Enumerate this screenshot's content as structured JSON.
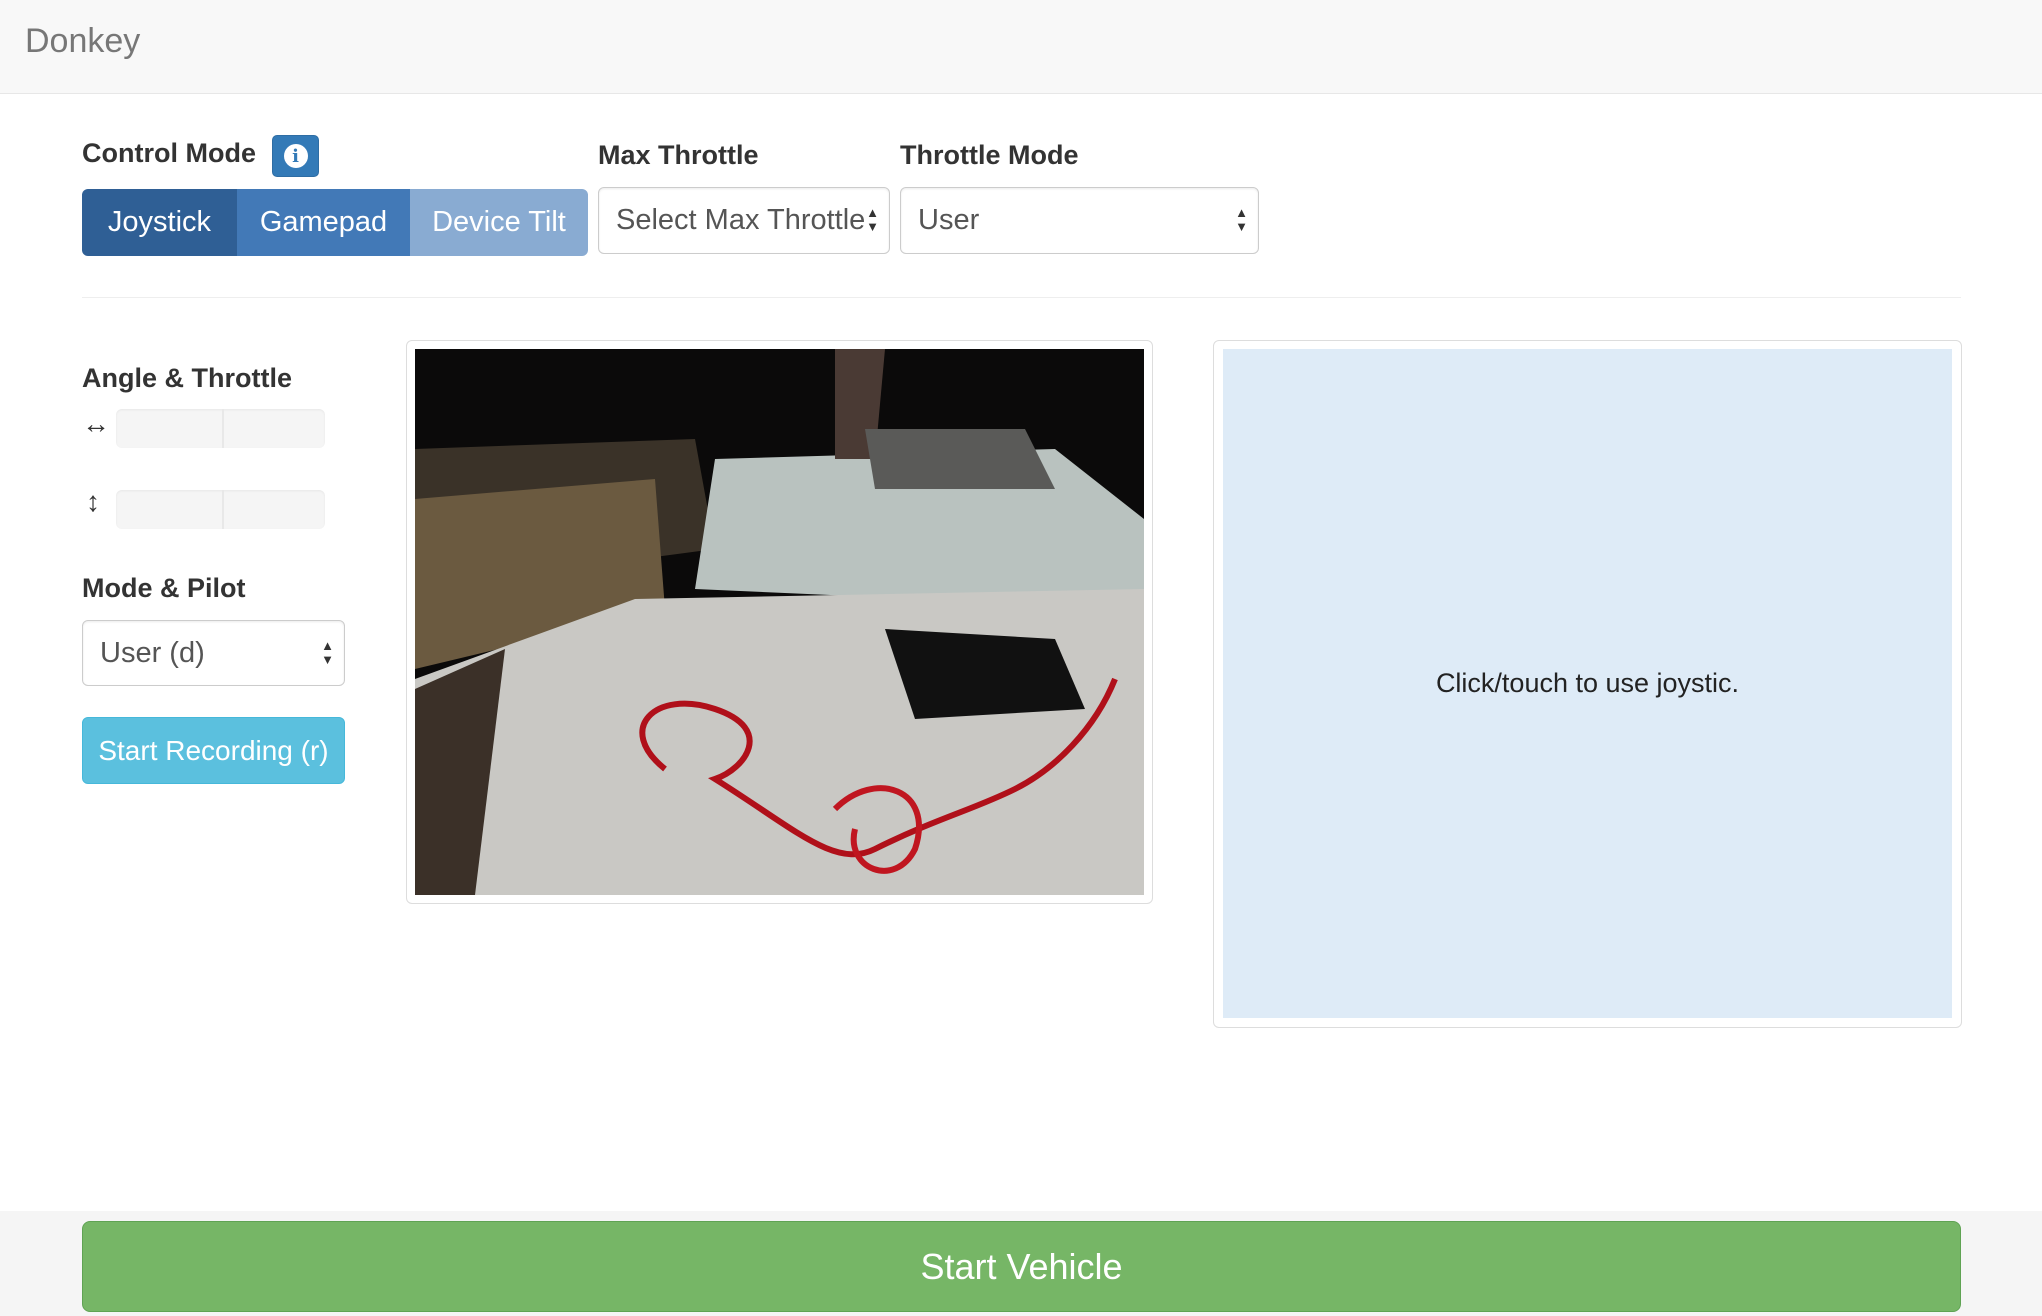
{
  "navbar": {
    "brand": "Donkey"
  },
  "control_mode": {
    "label": "Control Mode",
    "info_icon": "info-circle-icon",
    "options": [
      "Joystick",
      "Gamepad",
      "Device Tilt"
    ],
    "selected": "Joystick"
  },
  "max_throttle": {
    "label": "Max Throttle",
    "value": "Select Max Throttle"
  },
  "throttle_mode": {
    "label": "Throttle Mode",
    "value": "User"
  },
  "angle_throttle": {
    "label": "Angle & Throttle",
    "angle_icon": "arrows-horizontal-icon",
    "throttle_icon": "arrows-vertical-icon",
    "angle_value": 0,
    "throttle_value": 0
  },
  "mode_pilot": {
    "label": "Mode & Pilot",
    "value": "User (d)",
    "record_button": "Start Recording (r)"
  },
  "joystick": {
    "hint": "Click/touch to use joystic."
  },
  "footer": {
    "start_button": "Start Vehicle"
  },
  "colors": {
    "primary_dark": "#2f5f95",
    "primary": "#4279b7",
    "primary_light": "#89abd2",
    "info": "#5bc0de",
    "success": "#76b666",
    "joystick_bg": "#deebf7"
  }
}
